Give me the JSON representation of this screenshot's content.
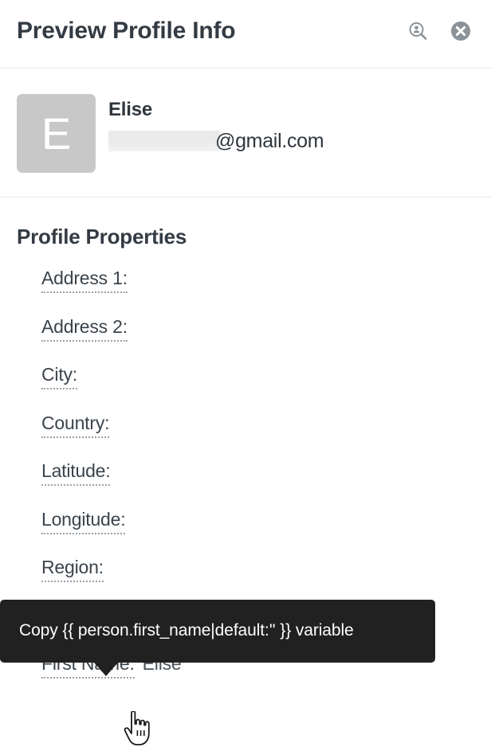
{
  "header": {
    "title": "Preview Profile Info",
    "search_profile_icon": "search-person-icon",
    "close_icon": "close-circle-icon"
  },
  "profile": {
    "avatar_initial": "E",
    "name": "Elise",
    "email_redacted": true,
    "email_visible_suffix": "@gmail.com"
  },
  "properties": {
    "section_title": "Profile Properties",
    "rows": [
      {
        "label": "Address 1:",
        "value": ""
      },
      {
        "label": "Address 2:",
        "value": ""
      },
      {
        "label": "City:",
        "value": ""
      },
      {
        "label": "Country:",
        "value": ""
      },
      {
        "label": "Latitude:",
        "value": ""
      },
      {
        "label": "Longitude:",
        "value": ""
      },
      {
        "label": "Region:",
        "value": ""
      },
      {
        "label": "",
        "value": ""
      },
      {
        "label": "First Name:",
        "value": "Elise"
      }
    ]
  },
  "tooltip": {
    "text": "Copy {{ person.first_name|default:'' }} variable",
    "background_color": "#212121",
    "text_color": "#ffffff"
  },
  "cursor": {
    "type": "pointing-hand"
  },
  "colors": {
    "page_background": "#ffffff",
    "divider": "#e6e8ea",
    "heading_text": "#333b44",
    "body_text": "#3b444c",
    "avatar_background": "#c8c8c8",
    "icon_gray": "#8b9298",
    "dotted_underline": "#9aa0a6"
  }
}
